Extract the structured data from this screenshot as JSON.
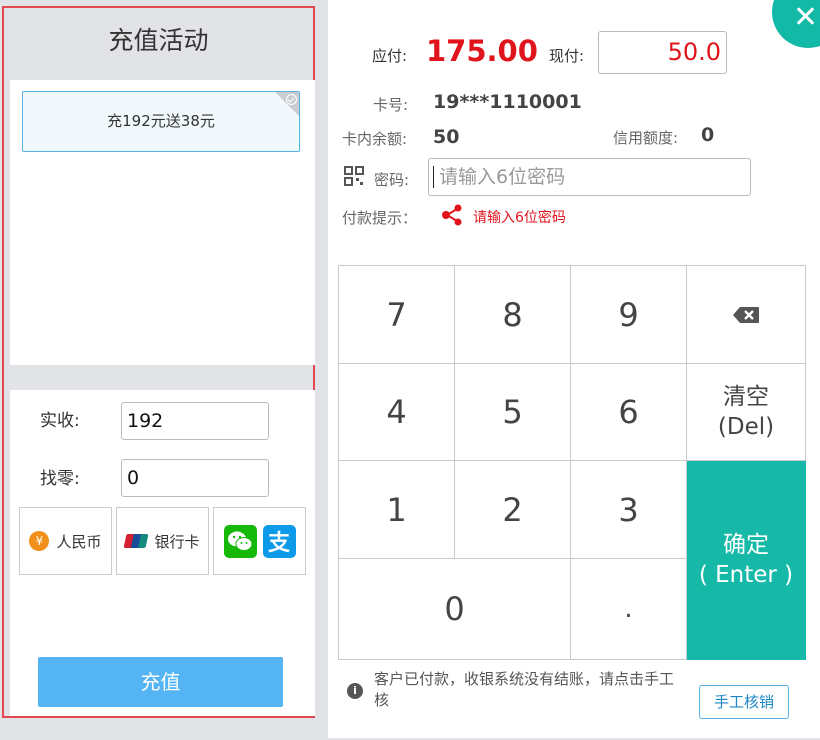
{
  "left": {
    "title": "充值活动",
    "promotions": [
      {
        "label": "充192元送38元"
      }
    ],
    "received_label": "实收:",
    "received_value": "192",
    "change_label": "找零:",
    "change_value": "0",
    "payment_methods": {
      "cash": "人民币",
      "cash_icon_glyph": "¥",
      "bank_card": "银行卡",
      "alipay_glyph": "支"
    },
    "submit_label": "充值"
  },
  "right": {
    "due_label": "应付:",
    "due_amount": "175.00",
    "paid_label": "现付:",
    "paid_value": "50.0",
    "card_no_label": "卡号:",
    "card_no": "19***1110001",
    "balance_label": "卡内余额:",
    "balance": "50",
    "credit_label": "信用额度:",
    "credit": "0",
    "password_label": "密码:",
    "password_placeholder": "请输入6位密码",
    "hint_label": "付款提示：",
    "hint_message": "请输入6位密码",
    "keypad": {
      "k7": "7",
      "k8": "8",
      "k9": "9",
      "k4": "4",
      "k5": "5",
      "k6": "6",
      "k1": "1",
      "k2": "2",
      "k3": "3",
      "k0": "0",
      "dot": ".",
      "clear_line1": "清空",
      "clear_line2": "(Del)",
      "enter_line1": "确定",
      "enter_line2": "( Enter )"
    },
    "footer_info": "客户已付款，收银系统没有结账，请点击手工核",
    "manual_button": "手工核销"
  },
  "colors": {
    "accent_teal": "#16b9a7",
    "amount_red": "#e0151c",
    "primary_blue": "#54b4f4",
    "frame_red": "#e2484f"
  },
  "icons": [
    "close-icon",
    "check-circle-icon",
    "yuan-coin-icon",
    "unionpay-icon",
    "wechat-icon",
    "alipay-icon",
    "qr-code-icon",
    "share-icon",
    "backspace-icon",
    "info-icon"
  ]
}
